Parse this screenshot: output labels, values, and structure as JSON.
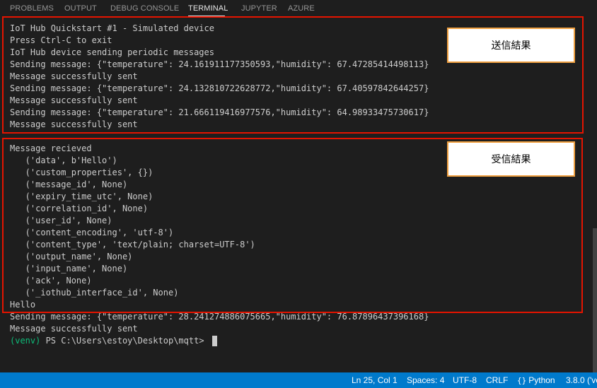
{
  "tabs": [
    {
      "label": "PROBLEMS"
    },
    {
      "label": "OUTPUT"
    },
    {
      "label": "DEBUG CONSOLE"
    },
    {
      "label": "TERMINAL",
      "active": true
    },
    {
      "label": "JUPYTER"
    },
    {
      "label": "AZURE"
    }
  ],
  "terminal": {
    "lines": [
      "IoT Hub Quickstart #1 - Simulated device",
      "Press Ctrl-C to exit",
      "IoT Hub device sending periodic messages",
      "Sending message: {\"temperature\": 24.161911177350593,\"humidity\": 67.47285414498113}",
      "Message successfully sent",
      "Sending message: {\"temperature\": 24.132810722628772,\"humidity\": 67.40597842644257}",
      "Message successfully sent",
      "Sending message: {\"temperature\": 21.666119416977576,\"humidity\": 64.98933475730617}",
      "Message successfully sent",
      "",
      "Message recieved",
      "   ('data', b'Hello')",
      "   ('custom_properties', {})",
      "   ('message_id', None)",
      "   ('expiry_time_utc', None)",
      "   ('correlation_id', None)",
      "   ('user_id', None)",
      "   ('content_encoding', 'utf-8')",
      "   ('content_type', 'text/plain; charset=UTF-8')",
      "   ('output_name', None)",
      "   ('input_name', None)",
      "   ('ack', None)",
      "   ('_iothub_interface_id', None)",
      "Hello",
      "Sending message: {\"temperature\": 28.241274886075665,\"humidity\": 76.87896437396168}",
      "Message successfully sent"
    ],
    "prompt_venv": "(venv)",
    "prompt_path": " PS C:\\Users\\estoy\\Desktop\\mqtt> "
  },
  "annotations": {
    "send_result": "送信結果",
    "receive_result": "受信結果"
  },
  "statusbar": {
    "position": "Ln 25, Col 1",
    "spaces": "Spaces: 4",
    "encoding": "UTF-8",
    "eol": "CRLF",
    "language": "Python",
    "interpreter": "3.8.0 ('ve"
  },
  "colors": {
    "background": "#1e1e1e",
    "text": "#cccccc",
    "venv": "#0dbc79",
    "highlight_border": "#e51400",
    "label_border": "#f0a040",
    "statusbar": "#007acc"
  },
  "icons": {
    "language": "curly-braces-icon"
  }
}
